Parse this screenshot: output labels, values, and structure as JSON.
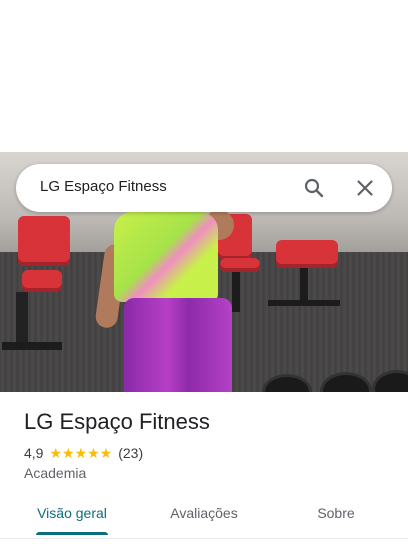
{
  "search": {
    "query": "LG Espaço Fitness",
    "search_icon": "search-icon",
    "close_icon": "close-icon"
  },
  "place": {
    "name": "LG Espaço Fitness",
    "rating": "4,9",
    "stars": "★★★★★",
    "reviews_count": "(23)",
    "category": "Academia"
  },
  "tabs": [
    {
      "label": "Visão geral",
      "active": true
    },
    {
      "label": "Avaliações",
      "active": false
    },
    {
      "label": "Sobre",
      "active": false
    }
  ],
  "colors": {
    "accent": "#0b6e7a",
    "star": "#fbbc04",
    "text": "#202124"
  }
}
